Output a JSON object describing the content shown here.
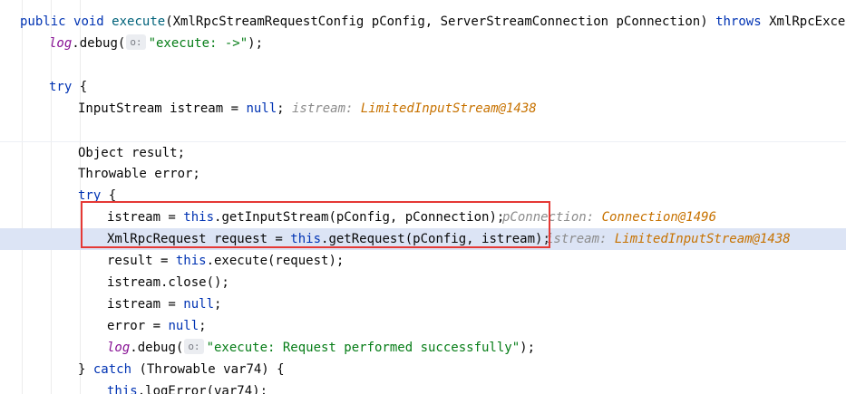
{
  "editor": {
    "sig": {
      "kw_public": "public",
      "kw_void": "void",
      "method": "execute",
      "params": "(XmlRpcStreamRequestConfig pConfig, ServerStreamConnection pConnection) ",
      "kw_throws": "throws",
      "exc": " XmlRpcException"
    },
    "log1": {
      "obj": "log",
      "call": ".debug(",
      "hint": "o:",
      "str": "\"execute: ->\"",
      "tail": ");"
    },
    "try1": {
      "kw": "try",
      "tail": " {"
    },
    "istream_decl": {
      "text": "InputStream istream = ",
      "kw_null": "null",
      "tail": ";",
      "inlay_name": "istream: ",
      "inlay_value": "LimitedInputStream@1438"
    },
    "obj_result": "Object result;",
    "throwable_error": "Throwable error;",
    "try2": {
      "kw": "try",
      "tail": " {"
    },
    "get_input": {
      "pre": "istream = ",
      "kw_this": "this",
      "post": ".getInputStream(pConfig, pConnection);",
      "inlay_name": "pConnection: ",
      "inlay_value": "Connection@1496"
    },
    "get_request": {
      "pre": "XmlRpcRequest request = ",
      "kw_this": "this",
      "post": ".getRequest(pConfig, istream);",
      "inlay_name": "istream: ",
      "inlay_value": "LimitedInputStream@1438"
    },
    "exec_line": {
      "pre": "result = ",
      "kw_this": "this",
      "post": ".execute(request);"
    },
    "close_line": "istream.close();",
    "istream_null": {
      "pre": "istream = ",
      "kw_null": "null",
      "tail": ";"
    },
    "error_null": {
      "pre": "error = ",
      "kw_null": "null",
      "tail": ";"
    },
    "log2": {
      "obj": "log",
      "call": ".debug(",
      "hint": "o:",
      "str": "\"execute: Request performed successfully\"",
      "tail": ");"
    },
    "catch_line": {
      "pre": "} ",
      "kw_catch": "catch",
      "post": " (Throwable var74) {"
    },
    "log_error": {
      "kw_this": "this",
      "post": ".logError(var74);"
    }
  }
}
